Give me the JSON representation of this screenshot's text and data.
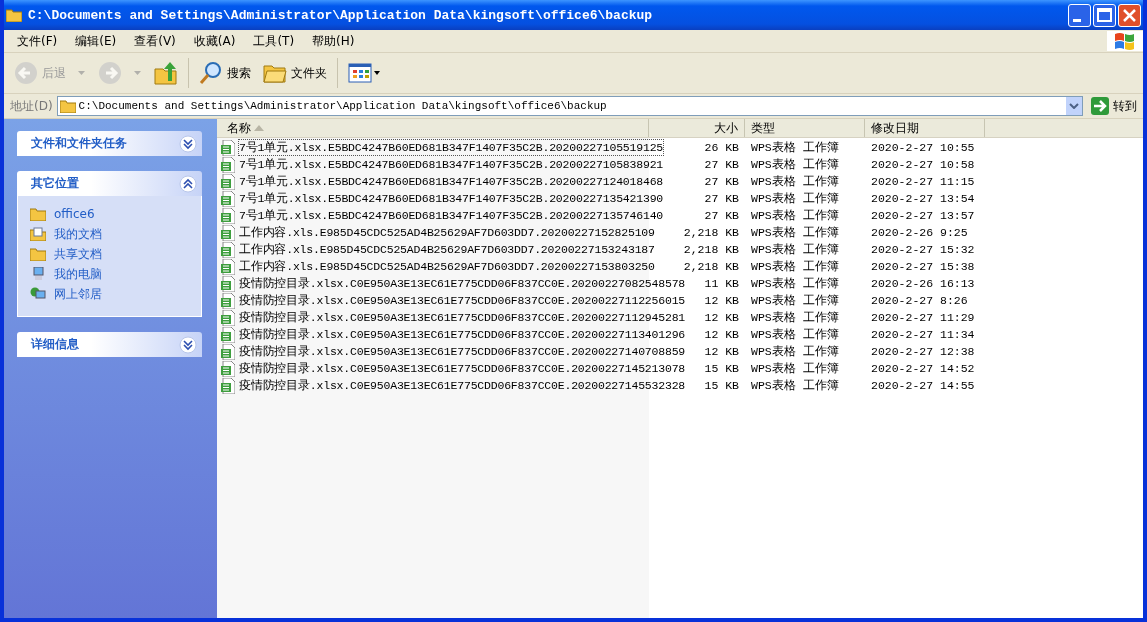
{
  "window": {
    "title": "C:\\Documents and Settings\\Administrator\\Application Data\\kingsoft\\office6\\backup"
  },
  "menu": [
    "文件(F)",
    "编辑(E)",
    "查看(V)",
    "收藏(A)",
    "工具(T)",
    "帮助(H)"
  ],
  "toolbar": [
    {
      "kind": "back",
      "label": "后退",
      "disabled": true
    },
    {
      "kind": "forward",
      "disabled": true
    },
    {
      "kind": "up"
    },
    {
      "kind": "search",
      "label": "搜索"
    },
    {
      "kind": "folders",
      "label": "文件夹"
    },
    {
      "kind": "views"
    }
  ],
  "address": {
    "label": "地址(D)",
    "value": "C:\\Documents and Settings\\Administrator\\Application Data\\kingsoft\\office6\\backup",
    "go": "转到"
  },
  "sidebar": [
    {
      "title": "文件和文件夹任务",
      "expanded": false
    },
    {
      "title": "其它位置",
      "expanded": true,
      "items": [
        {
          "kind": "folder",
          "label": "office6"
        },
        {
          "kind": "documents",
          "label": "我的文档"
        },
        {
          "kind": "folder",
          "label": "共享文档"
        },
        {
          "kind": "computer",
          "label": "我的电脑"
        },
        {
          "kind": "network",
          "label": "网上邻居"
        }
      ]
    },
    {
      "title": "详细信息",
      "expanded": false
    }
  ],
  "table": {
    "columns": [
      {
        "label": "名称",
        "sorted": true
      },
      {
        "label": "大小",
        "sorted": false
      },
      {
        "label": "类型",
        "sorted": false
      },
      {
        "label": "修改日期",
        "sorted": false
      }
    ],
    "rows": [
      {
        "name": "7号1单元.xlsx.E5BDC4247B60ED681B347F1407F35C2B.20200227105519125",
        "size": "26 KB",
        "type": "WPS表格 工作簿",
        "date": "2020-2-27 10:55",
        "focused": true
      },
      {
        "name": "7号1单元.xlsx.E5BDC4247B60ED681B347F1407F35C2B.20200227105838921",
        "size": "27 KB",
        "type": "WPS表格 工作簿",
        "date": "2020-2-27 10:58",
        "focused": false
      },
      {
        "name": "7号1单元.xlsx.E5BDC4247B60ED681B347F1407F35C2B.20200227124018468",
        "size": "27 KB",
        "type": "WPS表格 工作簿",
        "date": "2020-2-27 11:15",
        "focused": false
      },
      {
        "name": "7号1单元.xlsx.E5BDC4247B60ED681B347F1407F35C2B.20200227135421390",
        "size": "27 KB",
        "type": "WPS表格 工作簿",
        "date": "2020-2-27 13:54",
        "focused": false
      },
      {
        "name": "7号1单元.xlsx.E5BDC4247B60ED681B347F1407F35C2B.20200227135746140",
        "size": "27 KB",
        "type": "WPS表格 工作簿",
        "date": "2020-2-27 13:57",
        "focused": false
      },
      {
        "name": "工作内容.xls.E985D45CDC525AD4B25629AF7D603DD7.20200227152825109",
        "size": "2,218 KB",
        "type": "WPS表格 工作簿",
        "date": "2020-2-26 9:25",
        "focused": false
      },
      {
        "name": "工作内容.xls.E985D45CDC525AD4B25629AF7D603DD7.20200227153243187",
        "size": "2,218 KB",
        "type": "WPS表格 工作簿",
        "date": "2020-2-27 15:32",
        "focused": false
      },
      {
        "name": "工作内容.xls.E985D45CDC525AD4B25629AF7D603DD7.20200227153803250",
        "size": "2,218 KB",
        "type": "WPS表格 工作簿",
        "date": "2020-2-27 15:38",
        "focused": false
      },
      {
        "name": "疫情防控目录.xlsx.C0E950A3E13EC61E775CDD06F837CC0E.20200227082548578",
        "size": "11 KB",
        "type": "WPS表格 工作簿",
        "date": "2020-2-26 16:13",
        "focused": false
      },
      {
        "name": "疫情防控目录.xlsx.C0E950A3E13EC61E775CDD06F837CC0E.20200227112256015",
        "size": "12 KB",
        "type": "WPS表格 工作簿",
        "date": "2020-2-27 8:26",
        "focused": false
      },
      {
        "name": "疫情防控目录.xlsx.C0E950A3E13EC61E775CDD06F837CC0E.20200227112945281",
        "size": "12 KB",
        "type": "WPS表格 工作簿",
        "date": "2020-2-27 11:29",
        "focused": false
      },
      {
        "name": "疫情防控目录.xlsx.C0E950A3E13EC61E775CDD06F837CC0E.20200227113401296",
        "size": "12 KB",
        "type": "WPS表格 工作簿",
        "date": "2020-2-27 11:34",
        "focused": false
      },
      {
        "name": "疫情防控目录.xlsx.C0E950A3E13EC61E775CDD06F837CC0E.20200227140708859",
        "size": "12 KB",
        "type": "WPS表格 工作簿",
        "date": "2020-2-27 12:38",
        "focused": false
      },
      {
        "name": "疫情防控目录.xlsx.C0E950A3E13EC61E775CDD06F837CC0E.20200227145213078",
        "size": "15 KB",
        "type": "WPS表格 工作簿",
        "date": "2020-2-27 14:52",
        "focused": false
      },
      {
        "name": "疫情防控目录.xlsx.C0E950A3E13EC61E775CDD06F837CC0E.20200227145532328",
        "size": "15 KB",
        "type": "WPS表格 工作簿",
        "date": "2020-2-27 14:55",
        "focused": false
      }
    ]
  }
}
